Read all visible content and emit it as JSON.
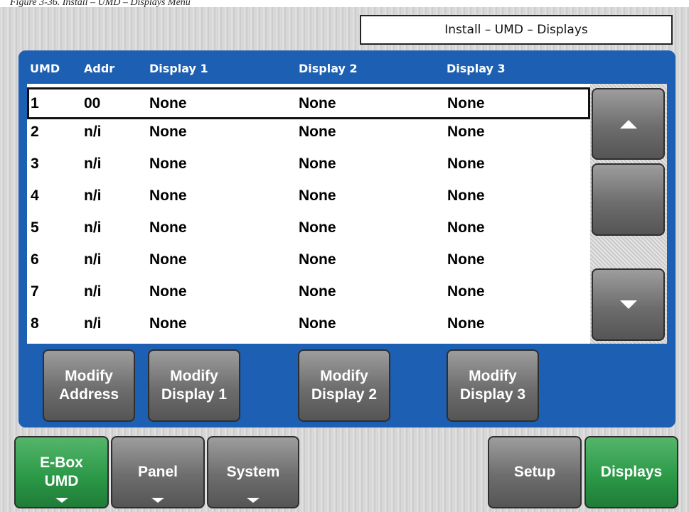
{
  "caption": "Figure 3-36. Install – UMD – Displays Menu",
  "window_title": "Install – UMD – Displays",
  "columns": [
    "UMD",
    "Addr",
    "Display 1",
    "Display 2",
    "Display 3"
  ],
  "rows": [
    {
      "umd": "1",
      "addr": "00",
      "d1": "None",
      "d2": "None",
      "d3": "None"
    },
    {
      "umd": "2",
      "addr": "n/i",
      "d1": "None",
      "d2": "None",
      "d3": "None"
    },
    {
      "umd": "3",
      "addr": "n/i",
      "d1": "None",
      "d2": "None",
      "d3": "None"
    },
    {
      "umd": "4",
      "addr": "n/i",
      "d1": "None",
      "d2": "None",
      "d3": "None"
    },
    {
      "umd": "5",
      "addr": "n/i",
      "d1": "None",
      "d2": "None",
      "d3": "None"
    },
    {
      "umd": "6",
      "addr": "n/i",
      "d1": "None",
      "d2": "None",
      "d3": "None"
    },
    {
      "umd": "7",
      "addr": "n/i",
      "d1": "None",
      "d2": "None",
      "d3": "None"
    },
    {
      "umd": "8",
      "addr": "n/i",
      "d1": "None",
      "d2": "None",
      "d3": "None"
    }
  ],
  "selected_row": 0,
  "modify_buttons": [
    {
      "line1": "Modify",
      "line2": "Address"
    },
    {
      "line1": "Modify",
      "line2": "Display 1"
    },
    {
      "line1": "Modify",
      "line2": "Display 2"
    },
    {
      "line1": "Modify",
      "line2": "Display 3"
    }
  ],
  "tabs": {
    "ebox": {
      "line1": "E-Box",
      "line2": "UMD"
    },
    "panel": "Panel",
    "system": "System",
    "setup": "Setup",
    "displays": "Displays"
  },
  "icons": {
    "scroll_up": "triangle-up-icon",
    "scroll_down": "triangle-down-icon",
    "menu_arrow": "triangle-down-icon"
  },
  "colors": {
    "blue_panel": "#1d5fb2",
    "active_tab": "#2c9a48",
    "button_grey": "#6d6d6d"
  }
}
